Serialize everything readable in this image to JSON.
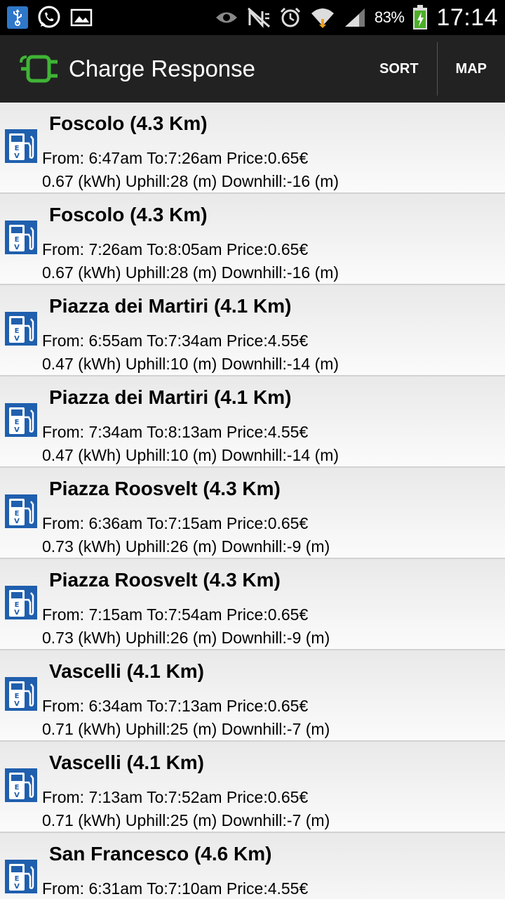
{
  "status_bar": {
    "battery_percent": "83%",
    "time": "17:14",
    "left_icons": [
      "usb-icon",
      "whatsapp-icon",
      "gallery-icon"
    ],
    "right_icons": [
      "eye-icon",
      "no-signal-icon",
      "alarm-icon",
      "wifi-icon",
      "signal-icon",
      "battery-icon"
    ]
  },
  "action_bar": {
    "title": "Charge Response",
    "sort_label": "SORT",
    "map_label": "MAP",
    "accent_color": "#3fb535"
  },
  "items": [
    {
      "title": "Foscolo (4.3 Km)",
      "line1": "From: 6:47am To:7:26am Price:0.65€",
      "line2": "0.67 (kWh) Uphill:28 (m) Downhill:-16 (m)"
    },
    {
      "title": "Foscolo (4.3 Km)",
      "line1": "From: 7:26am To:8:05am Price:0.65€",
      "line2": "0.67 (kWh) Uphill:28 (m) Downhill:-16 (m)"
    },
    {
      "title": "Piazza dei Martiri (4.1 Km)",
      "line1": "From: 6:55am To:7:34am Price:4.55€",
      "line2": "0.47 (kWh) Uphill:10 (m) Downhill:-14 (m)"
    },
    {
      "title": "Piazza dei Martiri (4.1 Km)",
      "line1": "From: 7:34am To:8:13am Price:4.55€",
      "line2": "0.47 (kWh) Uphill:10 (m) Downhill:-14 (m)"
    },
    {
      "title": "Piazza Roosvelt (4.3 Km)",
      "line1": "From: 6:36am To:7:15am Price:0.65€",
      "line2": "0.73 (kWh) Uphill:26 (m) Downhill:-9 (m)"
    },
    {
      "title": "Piazza Roosvelt (4.3 Km)",
      "line1": "From: 7:15am To:7:54am Price:0.65€",
      "line2": "0.73 (kWh) Uphill:26 (m) Downhill:-9 (m)"
    },
    {
      "title": "Vascelli (4.1 Km)",
      "line1": "From: 6:34am To:7:13am Price:0.65€",
      "line2": "0.71 (kWh) Uphill:25 (m) Downhill:-7 (m)"
    },
    {
      "title": "Vascelli (4.1 Km)",
      "line1": "From: 7:13am To:7:52am Price:0.65€",
      "line2": "0.71 (kWh) Uphill:25 (m) Downhill:-7 (m)"
    },
    {
      "title": "San Francesco (4.6 Km)",
      "line1": "From: 6:31am To:7:10am Price:4.55€",
      "line2": ""
    }
  ],
  "item_icon": "ev-charging-station-icon",
  "ev_icon_color": "#1f5fae"
}
